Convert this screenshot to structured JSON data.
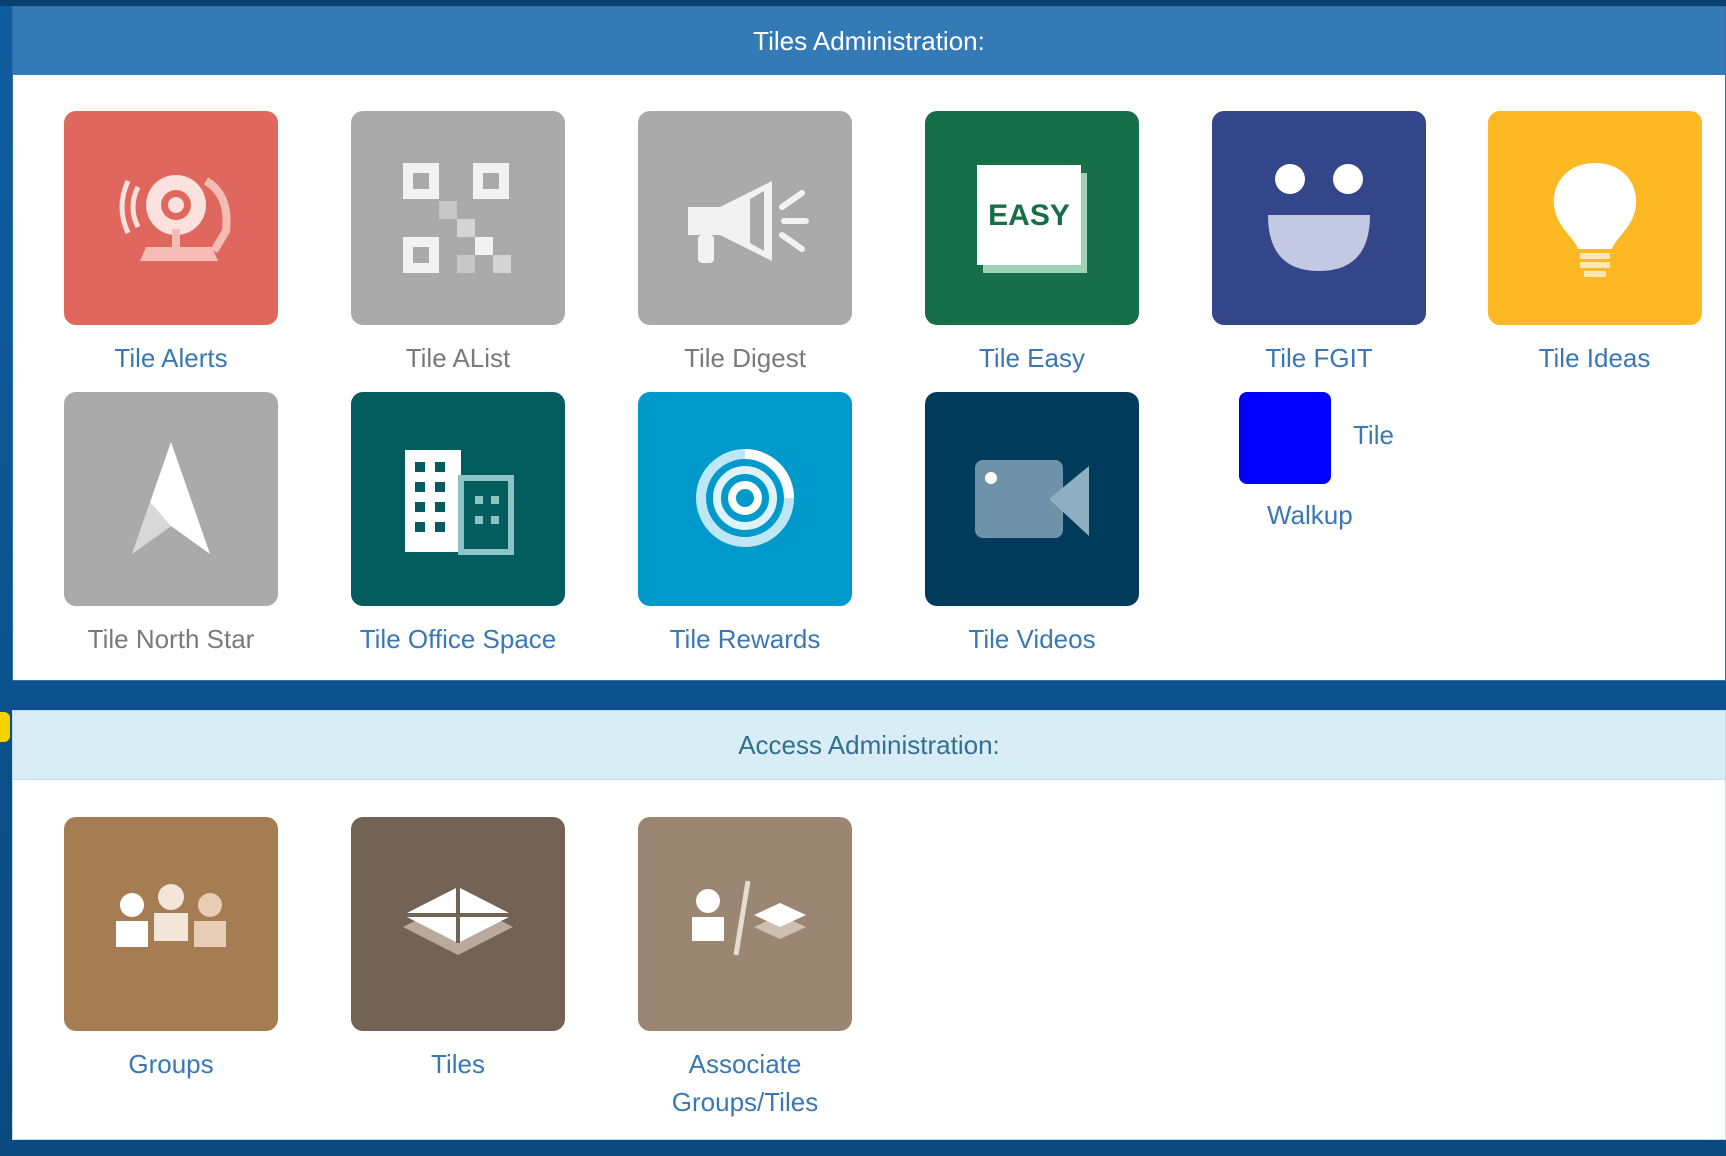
{
  "tiles_admin": {
    "title": "Tiles Administration:",
    "tiles": [
      {
        "label": "Tile Alerts",
        "color": "#e0675e",
        "icon": "alarm-bell-icon"
      },
      {
        "label": "Tile AList",
        "color": "#aaaaaa",
        "icon": "qr-code-icon"
      },
      {
        "label": "Tile Digest",
        "color": "#aaaaaa",
        "icon": "megaphone-icon"
      },
      {
        "label": "Tile Easy",
        "color": "#166f48",
        "icon": "easy-card-icon",
        "icon_text": "EASY"
      },
      {
        "label": "Tile FGIT",
        "color": "#33468a",
        "icon": "smiley-face-icon"
      },
      {
        "label": "Tile Ideas",
        "color": "#fdb823",
        "icon": "lightbulb-icon"
      },
      {
        "label": "Tile North Star",
        "color": "#aaaaaa",
        "icon": "north-arrow-icon"
      },
      {
        "label": "Tile Office Space",
        "color": "#035d5e",
        "icon": "office-building-icon"
      },
      {
        "label": "Tile Rewards",
        "color": "#0099cc",
        "icon": "target-rings-icon"
      },
      {
        "label": "Tile Videos",
        "color": "#003b5c",
        "icon": "video-camera-icon"
      }
    ],
    "walkup": {
      "label_line1": "Tile",
      "label_line2": "Walkup",
      "color": "#0000ff"
    }
  },
  "access_admin": {
    "title": "Access Administration:",
    "tiles": [
      {
        "label": "Groups",
        "color": "#a67d52",
        "icon": "people-group-icon"
      },
      {
        "label": "Tiles",
        "color": "#726355",
        "icon": "stacked-layers-icon"
      },
      {
        "label": "Associate Groups/Tiles",
        "label_line1": "Associate",
        "label_line2": "Groups/Tiles",
        "color": "#9b8573",
        "icon": "person-layers-icon"
      }
    ]
  }
}
